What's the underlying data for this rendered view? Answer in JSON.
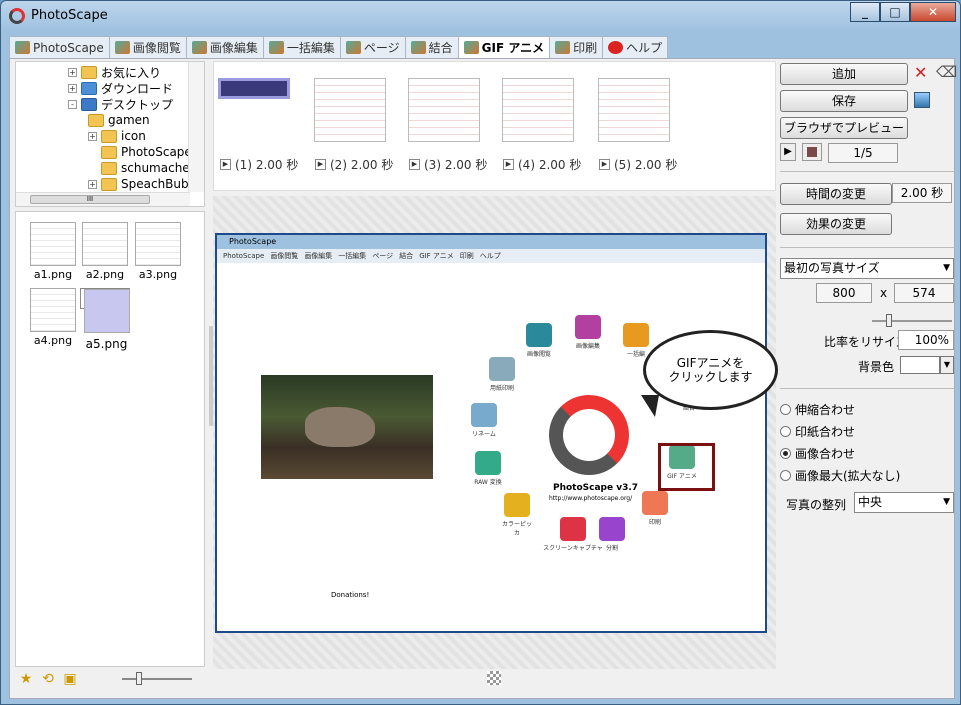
{
  "window": {
    "title": "PhotoScape",
    "min": "_",
    "max": "□",
    "close": "✕"
  },
  "tabs": [
    {
      "label": "PhotoScape"
    },
    {
      "label": "画像閲覧"
    },
    {
      "label": "画像編集"
    },
    {
      "label": "一括編集"
    },
    {
      "label": "ページ"
    },
    {
      "label": "結合"
    },
    {
      "label": "GIF アニメ"
    },
    {
      "label": "印刷"
    },
    {
      "label": "ヘルプ"
    }
  ],
  "tree": [
    {
      "label": "お気に入り",
      "expander": "+"
    },
    {
      "label": "ダウンロード",
      "expander": "+"
    },
    {
      "label": "デスクトップ",
      "expander": "-"
    },
    {
      "label": "gamen",
      "expander": ""
    },
    {
      "label": "icon",
      "expander": "+"
    },
    {
      "label": "PhotoScape",
      "expander": ""
    },
    {
      "label": "schumacher",
      "expander": ""
    },
    {
      "label": "SpeachBubb",
      "expander": "+"
    }
  ],
  "hscroll_marker": "III",
  "files": [
    {
      "name": "a1.png"
    },
    {
      "name": "a2.png"
    },
    {
      "name": "a3.png"
    },
    {
      "name": "a4.png"
    },
    {
      "name": "a5.png"
    }
  ],
  "frames": [
    {
      "label": "(1) 2.00 秒"
    },
    {
      "label": "(2) 2.00 秒"
    },
    {
      "label": "(3) 2.00 秒"
    },
    {
      "label": "(4) 2.00 秒"
    },
    {
      "label": "(5) 2.00 秒"
    }
  ],
  "screenshot": {
    "title": "PhotoScape",
    "tabs": [
      "PhotoScape",
      "画像閲覧",
      "画像編集",
      "一括編集",
      "ページ",
      "結合",
      "GIF アニメ",
      "印刷",
      "ヘルプ"
    ],
    "logo": "PhotoScape v3.7",
    "url": "http://www.photoscape.org/",
    "icons": [
      "画像閲覧",
      "画像編集",
      "一括編",
      "用紙印刷",
      "リネーム",
      "RAW 変換",
      "カラーピッカ",
      "スクリーンキャプチャ",
      "分割",
      "印刷",
      "結合",
      "GIF アニメ"
    ],
    "donations": "Donations!",
    "bubble": "GIFアニメを\nクリックします"
  },
  "right": {
    "add": "追加",
    "save": "保存",
    "preview": "ブラウザでプレビュー",
    "frame_counter": "1/5",
    "time_change": "時間の変更",
    "time_value": "2.00 秒",
    "effect_change": "効果の変更",
    "size_option": "最初の写真サイズ",
    "width": "800",
    "x": "x",
    "height": "574",
    "ratio_label": "比率をリサイズ",
    "ratio_value": "100%",
    "bg_label": "背景色",
    "radios": [
      {
        "label": "伸縮合わせ",
        "on": false
      },
      {
        "label": "印紙合わせ",
        "on": false
      },
      {
        "label": "画像合わせ",
        "on": true
      },
      {
        "label": "画像最大(拡大なし)",
        "on": false
      }
    ],
    "align_label": "写真の整列",
    "align_value": "中央"
  }
}
